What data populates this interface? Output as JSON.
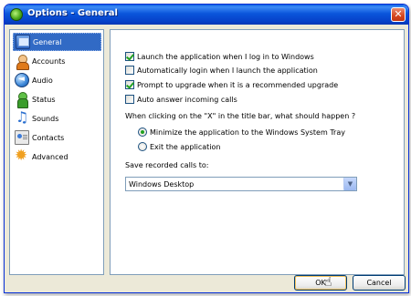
{
  "window": {
    "title": "Options - General",
    "close_glyph": "✕"
  },
  "nav": {
    "items": [
      {
        "label": "General",
        "icon": "general-icon",
        "selected": true
      },
      {
        "label": "Accounts",
        "icon": "accounts-icon"
      },
      {
        "label": "Audio",
        "icon": "audio-icon"
      },
      {
        "label": "Status",
        "icon": "status-icon"
      },
      {
        "label": "Sounds",
        "icon": "sounds-icon"
      },
      {
        "label": "Contacts",
        "icon": "contacts-icon"
      },
      {
        "label": "Advanced",
        "icon": "advanced-icon"
      }
    ]
  },
  "general": {
    "options": [
      {
        "label": "Launch the application when I log in to Windows",
        "checked": true
      },
      {
        "label": "Automatically login when I launch the application",
        "checked": false
      },
      {
        "label": "Prompt to upgrade when it is a recommended upgrade",
        "checked": true
      },
      {
        "label": "Auto answer incoming calls",
        "checked": false
      }
    ],
    "close_question": "When clicking on the \"X\" in the title bar, what should happen ?",
    "close_choices": [
      {
        "label": "Minimize the application to the Windows System Tray",
        "checked": true
      },
      {
        "label": "Exit the application",
        "checked": false
      }
    ],
    "save_calls_label": "Save recorded calls to:",
    "save_calls_value": "Windows Desktop"
  },
  "buttons": {
    "ok": "OK",
    "cancel": "Cancel"
  },
  "colors": {
    "titlebar": "#0a55db",
    "selected": "#316ac5",
    "check": "#21a121"
  }
}
